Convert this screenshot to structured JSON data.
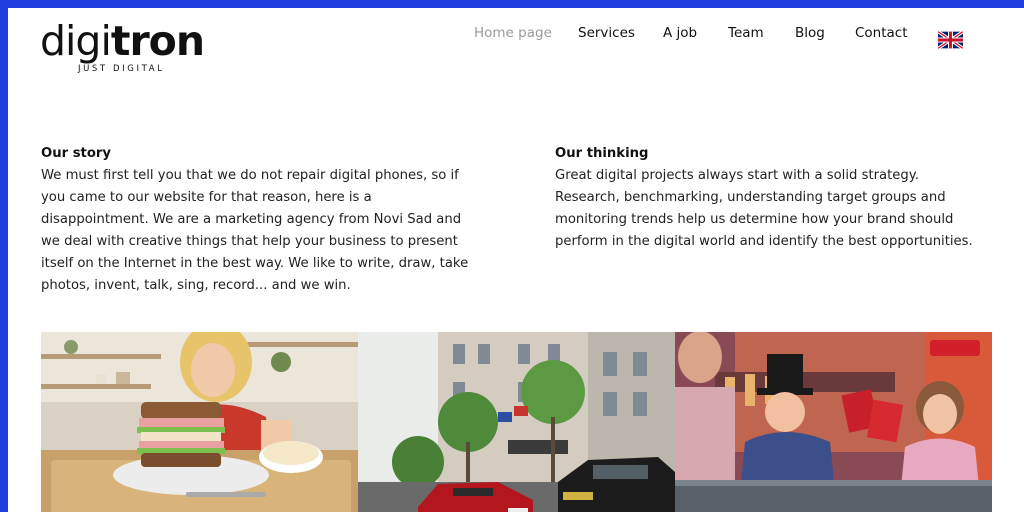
{
  "brand": {
    "name_light": "digi",
    "name_bold": "tron",
    "tagline": "JUST DIGITAL"
  },
  "nav": {
    "items": [
      {
        "label": "Home page",
        "active": true
      },
      {
        "label": "Services",
        "active": false
      },
      {
        "label": "A job",
        "active": false
      },
      {
        "label": "Team",
        "active": false
      },
      {
        "label": "Blog",
        "active": false
      },
      {
        "label": "Contact",
        "active": false
      }
    ],
    "language_icon": "uk-flag-icon"
  },
  "story": {
    "heading": "Our story",
    "body": "We must first tell you that we do not repair digital phones, so if you came to our website for that reason, here is a disappointment. We are a marketing agency from Novi Sad and we deal with creative things that help your business to present itself on the Internet in the best way. We like to write, draw, take photos, invent, talk, sing, record... and we win."
  },
  "thinking": {
    "heading": "Our thinking",
    "body": "Great digital projects always start with a solid strategy. Research, benchmarking, understanding target groups and monitoring trends help us determine how your brand should perform in the digital world and identify the best opportunities."
  },
  "colors": {
    "page_border": "#1f3fe0",
    "nav_active": "#9a9a9a",
    "text": "#222222"
  }
}
